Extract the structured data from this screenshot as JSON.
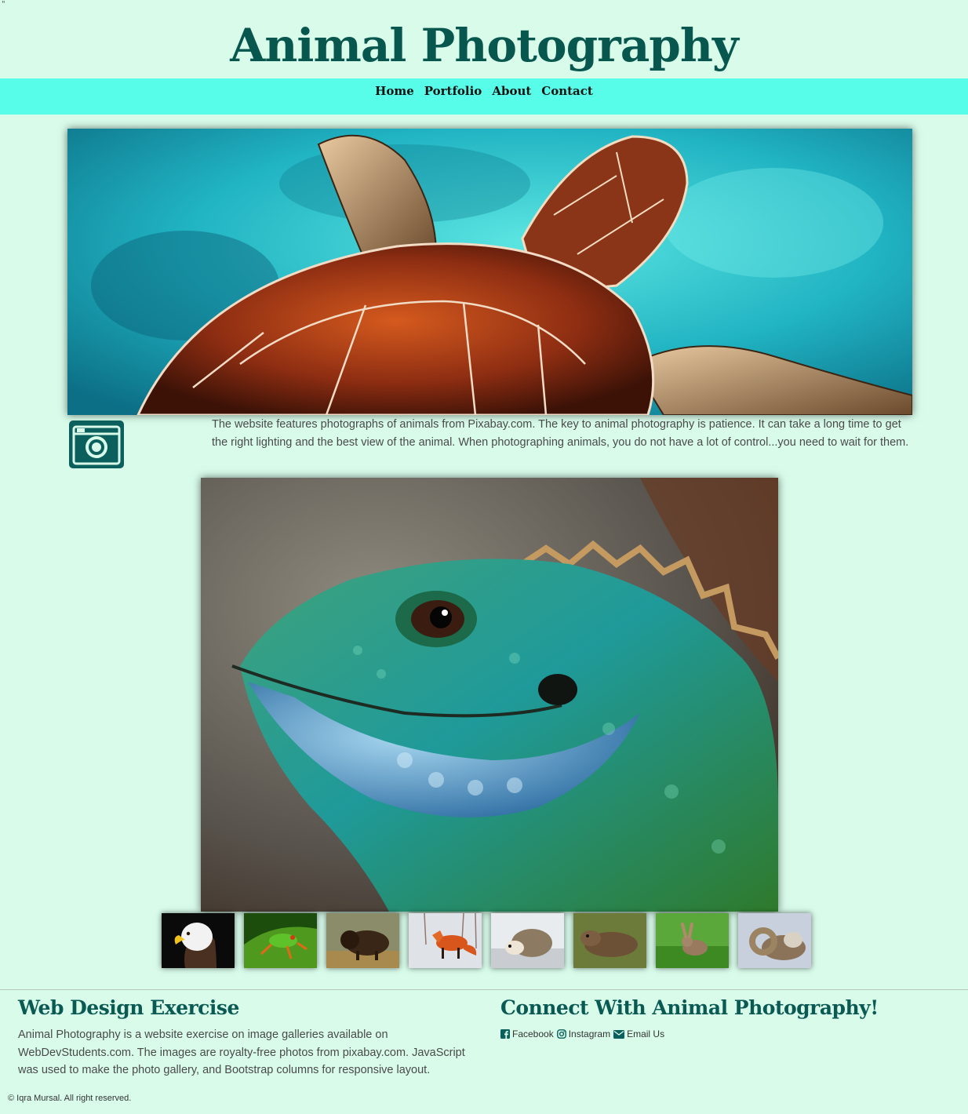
{
  "stray_mark": "\"",
  "header": {
    "title": "Animal Photography"
  },
  "nav": {
    "items": [
      "Home",
      "Portfolio",
      "About",
      "Contact"
    ]
  },
  "hero": {
    "image": "sea-turtle"
  },
  "intro": {
    "icon": "camera-icon",
    "text": "The website features photographs of animals from Pixabay.com. The key to animal photography is patience. It can take a long time to get the right lighting and the best view of the animal. When photographing animals, you do not have a lot of control...you need to wait for them."
  },
  "gallery": {
    "main_image": "iguana",
    "thumbnails": [
      "eagle",
      "frog",
      "bison",
      "fox",
      "hedgehog",
      "otter",
      "rabbit",
      "ram"
    ]
  },
  "footer": {
    "left_heading": "Web Design Exercise",
    "left_text": "Animal Photography is a website exercise on image galleries available on WebDevStudents.com. The images are royalty-free photos from pixabay.com. JavaScript was used to make the photo gallery, and Bootstrap columns for responsive layout.",
    "right_heading": "Connect With Animal Photography!",
    "links": [
      {
        "icon": "facebook-icon",
        "label": "Facebook"
      },
      {
        "icon": "instagram-icon",
        "label": "Instagram"
      },
      {
        "icon": "email-icon",
        "label": "Email Us"
      }
    ],
    "copyright": "© Iqra Mursal. All right reserved."
  },
  "colors": {
    "background": "#d8fbea",
    "nav_bar": "#57fde8",
    "title": "#08574f",
    "footer_heading": "#0a5a53"
  }
}
